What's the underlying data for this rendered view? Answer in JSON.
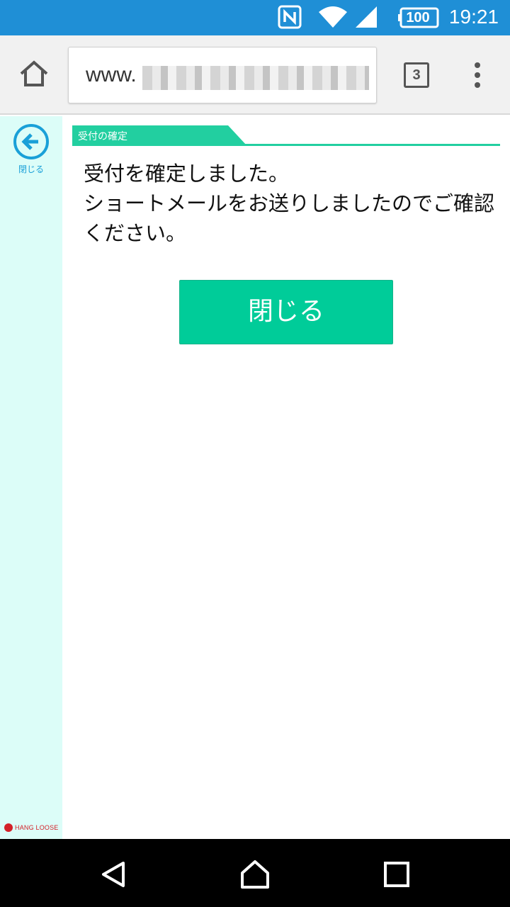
{
  "status_bar": {
    "time": "19:21",
    "battery_level": "100",
    "icons": [
      "nfc-icon",
      "wifi-icon",
      "cell-signal-icon",
      "battery-icon"
    ],
    "background_color": "#1f8fd6"
  },
  "browser": {
    "url_prefix": "www.",
    "tab_count": "3",
    "icons": [
      "home-icon",
      "tabs-icon",
      "overflow-menu-icon"
    ]
  },
  "sidebar": {
    "back_label": "閉じる",
    "back_icon": "arrow-left-circle-icon",
    "brand": "HANG LOOSE",
    "background_color": "#dcfdf8"
  },
  "main": {
    "section_title": "受付の確定",
    "message_lines": [
      "受付を確定しました。",
      "ショートメールをお送りしましたのでご確認ください。"
    ],
    "close_button_label": "閉じる",
    "accent_color": "#00cc99"
  },
  "nav_bar": {
    "icons": [
      "back-triangle-icon",
      "home-icon",
      "recent-apps-icon"
    ]
  }
}
